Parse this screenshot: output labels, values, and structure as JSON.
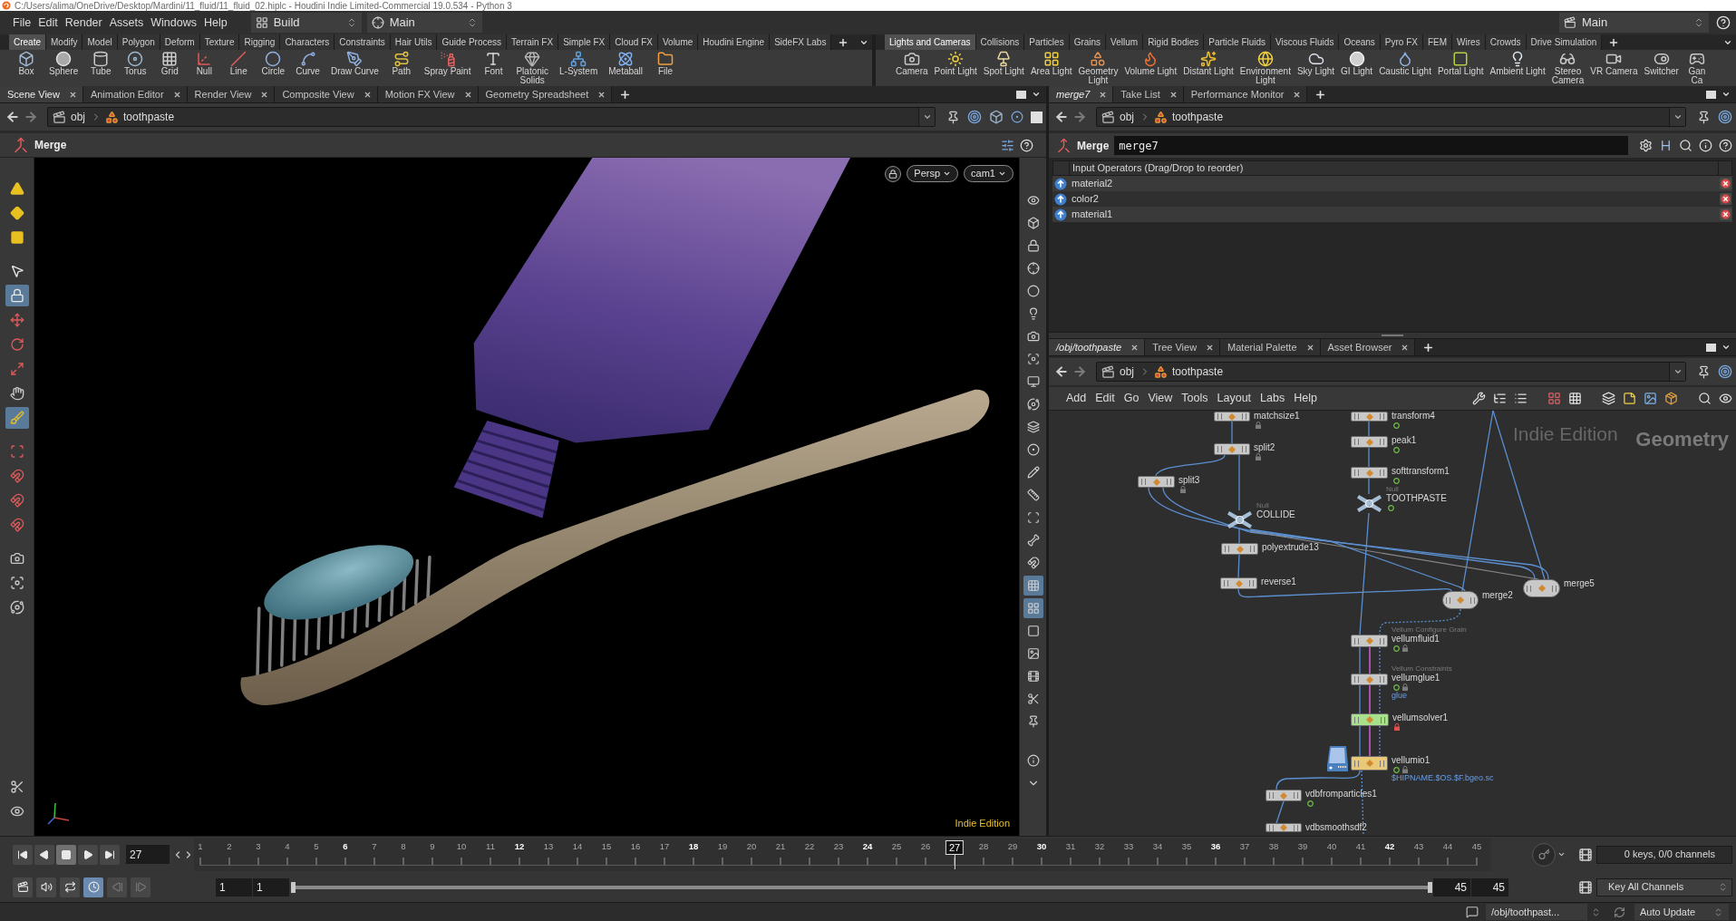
{
  "window": {
    "title": "C:/Users/alima/OneDrive/Desktop/Mardini/11_fluid/11_fluid_02.hiplc - Houdini Indie Limited-Commercial 19.0.534 - Python 3"
  },
  "menu_bar": {
    "items": [
      "File",
      "Edit",
      "Render",
      "Assets",
      "Windows",
      "Help"
    ],
    "desktop": "Build",
    "radial_menu": "Main",
    "take": "Main"
  },
  "shelves": [
    {
      "tabs": [
        {
          "label": "Create",
          "selected": true
        },
        {
          "label": "Modify",
          "selected": false
        },
        {
          "label": "Model",
          "selected": false
        },
        {
          "label": "Polygon",
          "selected": false
        },
        {
          "label": "Deform",
          "selected": false
        },
        {
          "label": "Texture",
          "selected": false
        },
        {
          "label": "Rigging",
          "selected": false
        },
        {
          "label": "Characters",
          "selected": false
        },
        {
          "label": "Constraints",
          "selected": false
        },
        {
          "label": "Hair Utils",
          "selected": false
        },
        {
          "label": "Guide Process",
          "selected": false
        },
        {
          "label": "Terrain FX",
          "selected": false
        },
        {
          "label": "Simple FX",
          "selected": false
        },
        {
          "label": "Cloud FX",
          "selected": false
        },
        {
          "label": "Volume",
          "selected": false
        },
        {
          "label": "Houdini Engine",
          "selected": false
        },
        {
          "label": "SideFX Labs",
          "selected": false
        }
      ],
      "tools": [
        "Box",
        "Sphere",
        "Tube",
        "Torus",
        "Grid",
        "Null",
        "Line",
        "Circle",
        "Curve",
        "Draw Curve",
        "Path",
        "Spray Paint",
        "Font",
        "Platonic\nSolids",
        "L-System",
        "Metaball",
        "File"
      ]
    },
    {
      "tabs": [
        {
          "label": "Lights and Cameras",
          "selected": true
        },
        {
          "label": "Collisions",
          "selected": false
        },
        {
          "label": "Particles",
          "selected": false
        },
        {
          "label": "Grains",
          "selected": false
        },
        {
          "label": "Vellum",
          "selected": false
        },
        {
          "label": "Rigid Bodies",
          "selected": false
        },
        {
          "label": "Particle Fluids",
          "selected": false
        },
        {
          "label": "Viscous Fluids",
          "selected": false
        },
        {
          "label": "Oceans",
          "selected": false
        },
        {
          "label": "Pyro FX",
          "selected": false
        },
        {
          "label": "FEM",
          "selected": false
        },
        {
          "label": "Wires",
          "selected": false
        },
        {
          "label": "Crowds",
          "selected": false
        },
        {
          "label": "Drive Simulation",
          "selected": false
        }
      ],
      "tools": [
        "Camera",
        "Point Light",
        "Spot Light",
        "Area Light",
        "Geometry\nLight",
        "Volume Light",
        "Distant Light",
        "Environment\nLight",
        "Sky Light",
        "GI Light",
        "Caustic Light",
        "Portal Light",
        "Ambient Light",
        "Stereo\nCamera",
        "VR Camera",
        "Switcher",
        "Gan\nCa"
      ]
    }
  ],
  "scene_pane": {
    "tabs": [
      {
        "label": "Scene View",
        "selected": true,
        "follows_selection": false
      },
      {
        "label": "Animation Editor",
        "selected": false,
        "follows_selection": false
      },
      {
        "label": "Render View",
        "selected": false,
        "follows_selection": false
      },
      {
        "label": "Composite View",
        "selected": false,
        "follows_selection": false
      },
      {
        "label": "Motion FX View",
        "selected": false,
        "follows_selection": false
      },
      {
        "label": "Geometry Spreadsheet",
        "selected": false,
        "follows_selection": false
      }
    ],
    "path": [
      "obj",
      "toothpaste"
    ],
    "operator": "Merge",
    "left_tools": [
      {
        "selected": false
      },
      {
        "selected": false
      },
      {
        "selected": false
      },
      {
        "selected": false
      },
      {
        "selected": true
      },
      {
        "selected": false
      },
      {
        "selected": false
      },
      {
        "selected": false
      },
      {
        "selected": false
      },
      {
        "selected": true
      },
      {
        "selected": false
      },
      {
        "selected": false
      },
      {
        "selected": false
      },
      {
        "selected": false
      },
      {
        "selected": false
      },
      {
        "selected": false
      },
      {
        "selected": false
      },
      {
        "selected": false
      },
      {
        "selected": false
      }
    ],
    "right_tools": [
      {
        "selected": false
      },
      {
        "selected": false
      },
      {
        "selected": false
      },
      {
        "selected": false
      },
      {
        "selected": false
      },
      {
        "selected": false
      },
      {
        "selected": false
      },
      {
        "selected": false
      },
      {
        "selected": false
      },
      {
        "selected": false
      },
      {
        "selected": false
      },
      {
        "selected": false
      },
      {
        "selected": false
      },
      {
        "selected": false
      },
      {
        "selected": false
      },
      {
        "selected": false
      },
      {
        "selected": false
      },
      {
        "selected": true
      },
      {
        "selected": true
      },
      {
        "selected": false
      },
      {
        "selected": false
      },
      {
        "selected": false
      },
      {
        "selected": false
      },
      {
        "selected": false
      },
      {
        "selected": false
      },
      {
        "selected": false
      }
    ],
    "view": {
      "projection": "Persp",
      "camera": "cam1",
      "edition_label": "Indie Edition"
    }
  },
  "parameter_pane": {
    "tabs": [
      {
        "label": "merge7",
        "selected": true,
        "follows_selection": true
      },
      {
        "label": "Take List",
        "selected": false,
        "follows_selection": false
      },
      {
        "label": "Performance Monitor",
        "selected": false,
        "follows_selection": false
      }
    ],
    "path": [
      "obj",
      "toothpaste"
    ],
    "node_type": "Merge",
    "node_name": "merge7",
    "list_header": "Input Operators (Drag/Drop to reorder)",
    "inputs": [
      "material2",
      "color2",
      "material1"
    ]
  },
  "network_pane": {
    "tabs": [
      {
        "label": "/obj/toothpaste",
        "selected": true,
        "follows_selection": true
      },
      {
        "label": "Tree View",
        "selected": false,
        "follows_selection": false
      },
      {
        "label": "Material Palette",
        "selected": false,
        "follows_selection": false
      },
      {
        "label": "Asset Browser",
        "selected": false,
        "follows_selection": false
      }
    ],
    "path": [
      "obj",
      "toothpaste"
    ],
    "menu": [
      "Add",
      "Edit",
      "Go",
      "View",
      "Tools",
      "Layout",
      "Labs",
      "Help"
    ],
    "context_label": "Geometry",
    "edition_label": "Indie Edition",
    "nodes": [
      {
        "name": "matchsize1",
        "kind": "sop",
        "color": "#c8c8c8",
        "badges": [
          {
            "kind": "lock"
          }
        ]
      },
      {
        "name": "transform4",
        "kind": "sop",
        "color": "#c8c8c8",
        "badges": [
          {
            "kind": "ring"
          }
        ]
      },
      {
        "name": "split2",
        "kind": "sop",
        "color": "#c8c8c8",
        "badges": [
          {
            "kind": "lock"
          }
        ]
      },
      {
        "name": "peak1",
        "kind": "sop",
        "color": "#c8c8c8",
        "badges": [
          {
            "kind": "ring"
          }
        ]
      },
      {
        "name": "split3",
        "kind": "sop",
        "color": "#c8c8c8",
        "badges": [
          {
            "kind": "lock"
          }
        ]
      },
      {
        "name": "softtransform1",
        "kind": "sop",
        "color": "#c8c8c8",
        "badges": [
          {
            "kind": "ring"
          }
        ]
      },
      {
        "name": "TOOTHPASTE",
        "subtitle": "Null",
        "kind": "null",
        "color": "#a6bdd4",
        "badges": [
          {
            "kind": "ring"
          }
        ]
      },
      {
        "name": "COLLIDE",
        "subtitle": "Null",
        "kind": "null",
        "color": "#a6bdd4"
      },
      {
        "name": "polyextrude13",
        "kind": "sop",
        "color": "#c8c8c8"
      },
      {
        "name": "reverse1",
        "kind": "sop",
        "color": "#c8c8c8"
      },
      {
        "name": "merge2",
        "kind": "merge",
        "color": "#c8c8c8"
      },
      {
        "name": "merge5",
        "kind": "merge",
        "color": "#c8c8c8"
      },
      {
        "name": "vellumfluid1",
        "subtitle": "Vellum Configure Grain",
        "kind": "sop",
        "color": "#c8c8c8",
        "badges": [
          {
            "kind": "ring"
          },
          {
            "kind": "lock"
          }
        ]
      },
      {
        "name": "vellumglue1",
        "subtitle": "Vellum Constraints",
        "kind": "sop",
        "color": "#c8c8c8",
        "badges": [
          {
            "kind": "ring"
          },
          {
            "kind": "lock"
          }
        ],
        "note": "glue"
      },
      {
        "name": "vellumsolver1",
        "kind": "sop",
        "color": "#a9e08c",
        "badges": [
          {
            "kind": "alert_lock"
          }
        ]
      },
      {
        "name": "vellumio1",
        "kind": "cache",
        "color": "#e9c877",
        "badges": [
          {
            "kind": "ring"
          },
          {
            "kind": "lock"
          }
        ],
        "note": "$HIPNAME.$OS.$F.bgeo.sc"
      },
      {
        "name": "vdbfromparticles1",
        "kind": "sop",
        "color": "#c8c8c8",
        "badges": [
          {
            "kind": "ring"
          }
        ]
      },
      {
        "name": "vdbsmoothsdf2",
        "kind": "sop",
        "color": "#c8c8c8"
      }
    ]
  },
  "timeline": {
    "playback_buttons": [
      {
        "selected": false
      },
      {
        "selected": false
      },
      {
        "selected": true
      },
      {
        "selected": false
      },
      {
        "selected": false
      }
    ],
    "current_frame": "27",
    "ruler": [
      {
        "label": "1",
        "major": false
      },
      {
        "label": "2",
        "major": false
      },
      {
        "label": "3",
        "major": false
      },
      {
        "label": "4",
        "major": false
      },
      {
        "label": "5",
        "major": false
      },
      {
        "label": "6",
        "major": true
      },
      {
        "label": "7",
        "major": false
      },
      {
        "label": "8",
        "major": false
      },
      {
        "label": "9",
        "major": false
      },
      {
        "label": "10",
        "major": false
      },
      {
        "label": "11",
        "major": false
      },
      {
        "label": "12",
        "major": true
      },
      {
        "label": "13",
        "major": false
      },
      {
        "label": "14",
        "major": false
      },
      {
        "label": "15",
        "major": false
      },
      {
        "label": "16",
        "major": false
      },
      {
        "label": "17",
        "major": false
      },
      {
        "label": "18",
        "major": true
      },
      {
        "label": "19",
        "major": false
      },
      {
        "label": "20",
        "major": false
      },
      {
        "label": "21",
        "major": false
      },
      {
        "label": "22",
        "major": false
      },
      {
        "label": "23",
        "major": false
      },
      {
        "label": "24",
        "major": true
      },
      {
        "label": "25",
        "major": false
      },
      {
        "label": "26",
        "major": false
      },
      {
        "label": "28",
        "major": false
      },
      {
        "label": "29",
        "major": false
      },
      {
        "label": "30",
        "major": true
      },
      {
        "label": "31",
        "major": false
      },
      {
        "label": "32",
        "major": false
      },
      {
        "label": "33",
        "major": false
      },
      {
        "label": "34",
        "major": false
      },
      {
        "label": "35",
        "major": false
      },
      {
        "label": "36",
        "major": true
      },
      {
        "label": "37",
        "major": false
      },
      {
        "label": "38",
        "major": false
      },
      {
        "label": "39",
        "major": false
      },
      {
        "label": "40",
        "major": false
      },
      {
        "label": "41",
        "major": false
      },
      {
        "label": "42",
        "major": true
      },
      {
        "label": "43",
        "major": false
      },
      {
        "label": "44",
        "major": false
      },
      {
        "label": "45",
        "major": false
      }
    ],
    "playhead": {
      "label": "27",
      "level": 0.591
    },
    "playback_options": [
      {
        "selected": false
      },
      {
        "selected": false
      },
      {
        "selected": false
      },
      {
        "selected": true
      },
      {
        "selected": false
      },
      {
        "selected": false
      }
    ],
    "range_start": [
      "1",
      "1"
    ],
    "range_slider": {
      "level": 1
    },
    "range_end": [
      "45",
      "45"
    ],
    "keys_info": "0 keys, 0/0 channels",
    "key_mode": "Key All Channels"
  },
  "status_bar": {
    "path": "/obj/toothpast...",
    "update_mode": "Auto Update"
  }
}
